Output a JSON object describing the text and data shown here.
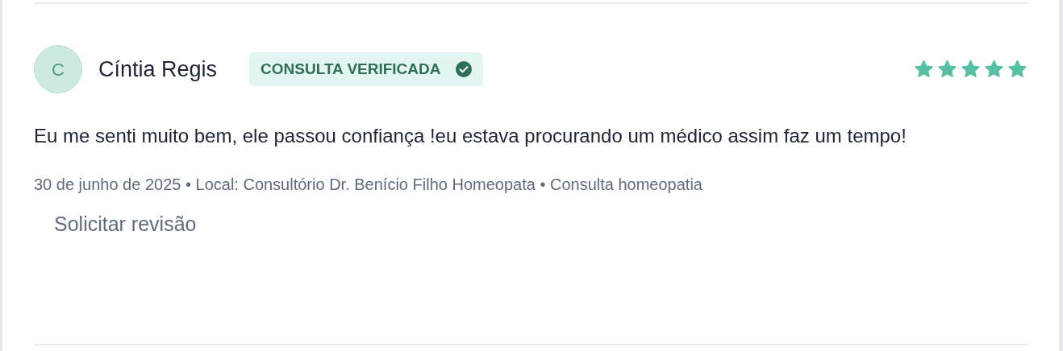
{
  "review": {
    "avatar_initial": "C",
    "author": "Cíntia Regis",
    "badge": {
      "label": "CONSULTA VERIFICADA",
      "verified": true
    },
    "stars": 5,
    "text": "Eu me senti muito bem, ele passou confiança !eu estava procurando um médico assim faz um tempo!",
    "meta": "30 de junho de 2025 • Local: Consultório Dr. Benício Filho Homeopata • Consulta homeopatia",
    "action": "Solicitar revisão"
  }
}
